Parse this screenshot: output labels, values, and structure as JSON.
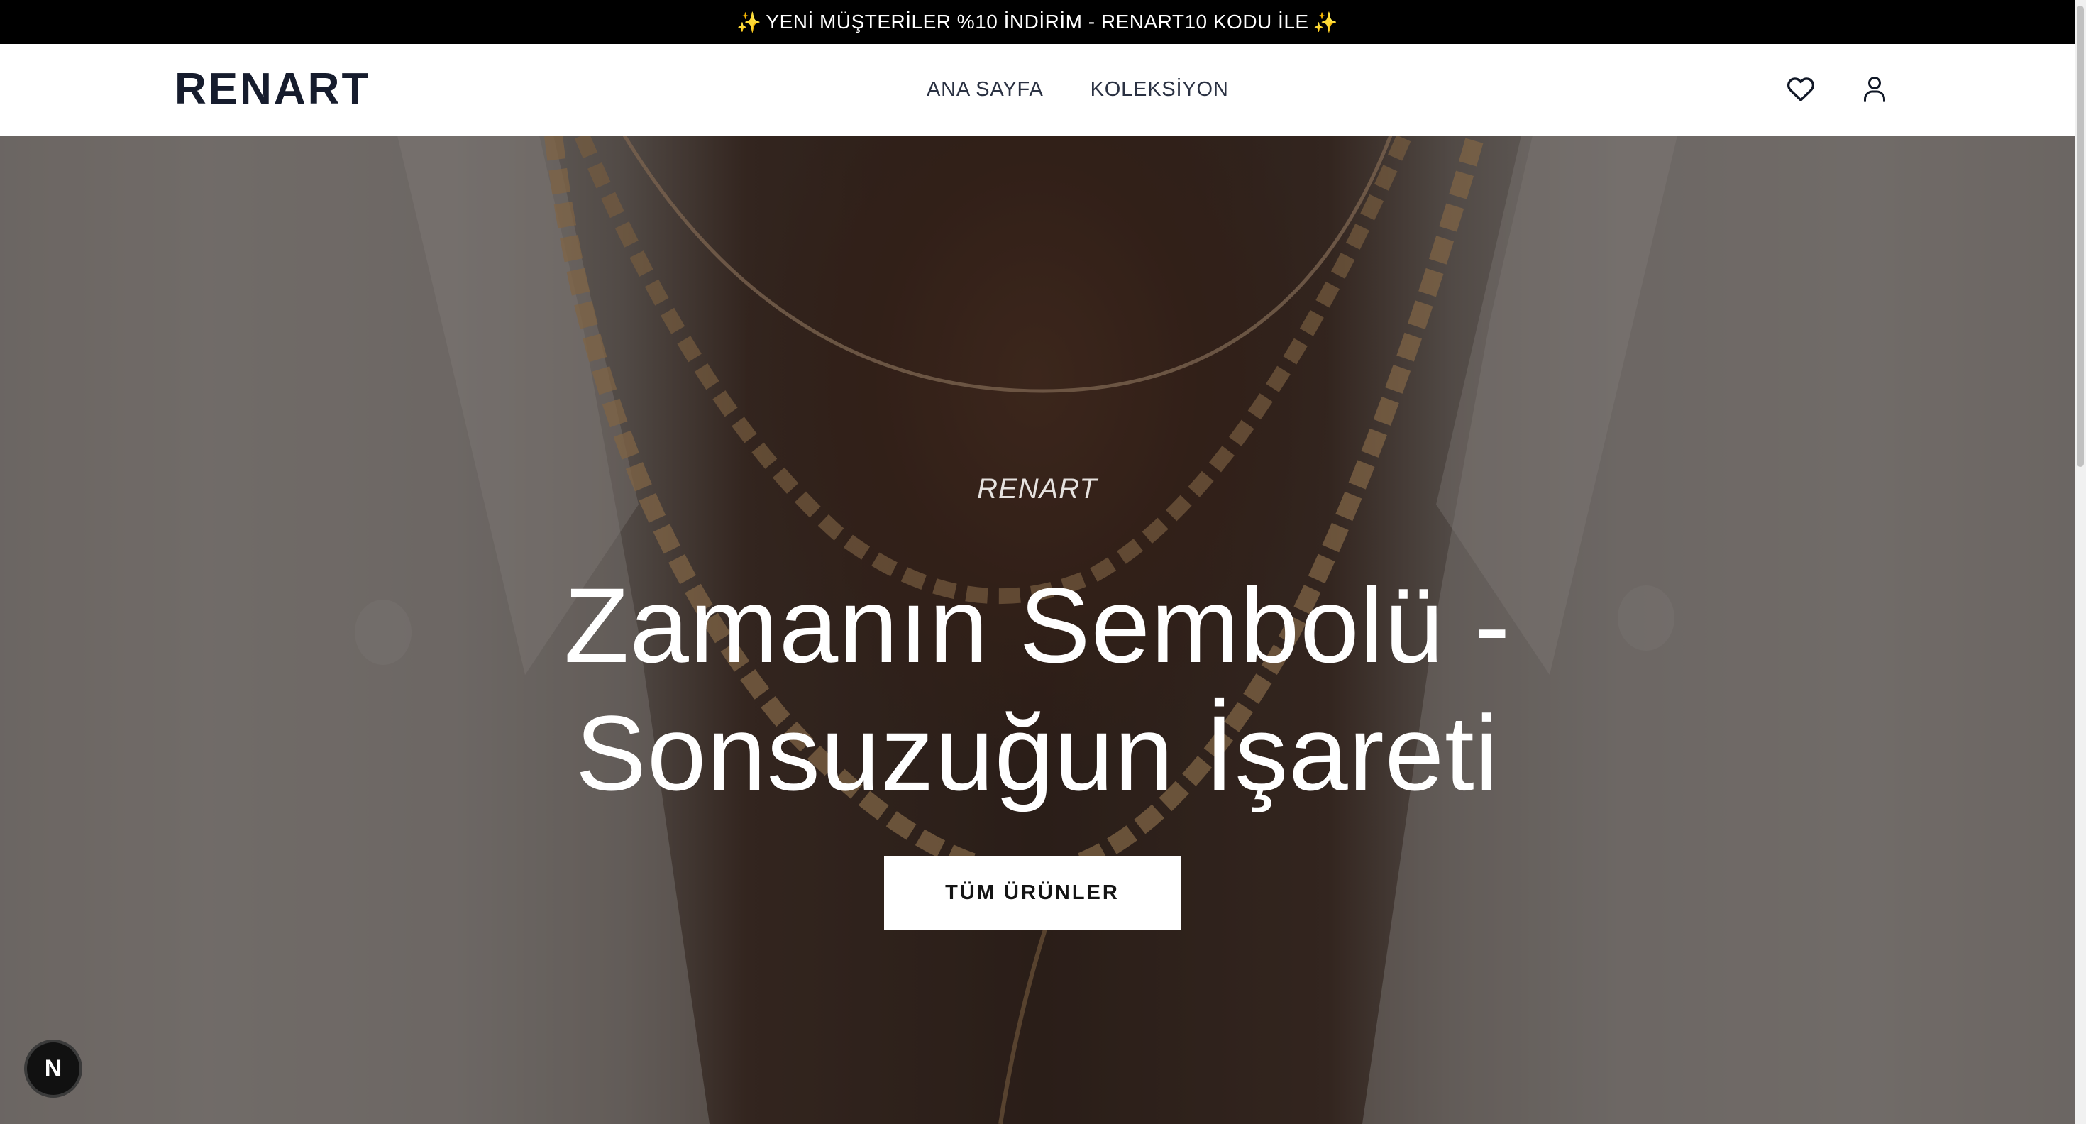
{
  "announcement": {
    "sparkle_left": "✨",
    "text": "YENİ MÜŞTERİLER %10 İNDİRİM - RENART10 KODU İLE",
    "sparkle_right": "✨"
  },
  "header": {
    "logo": "RENART",
    "nav": [
      "ANA SAYFA",
      "KOLEKSİYON"
    ],
    "icons": [
      "heart-icon",
      "user-icon"
    ]
  },
  "hero": {
    "brand": "RENART",
    "title_line1": "Zamanın Sembolü -",
    "title_line2": "Sonsuzuğun İşareti",
    "cta_label": "TÜM ÜRÜNLER"
  },
  "dev_badge": {
    "label": "N"
  },
  "colors": {
    "announcement_bg": "#000000",
    "header_bg": "#ffffff",
    "logo": "#161c2d",
    "cta_bg": "#ffffff"
  }
}
